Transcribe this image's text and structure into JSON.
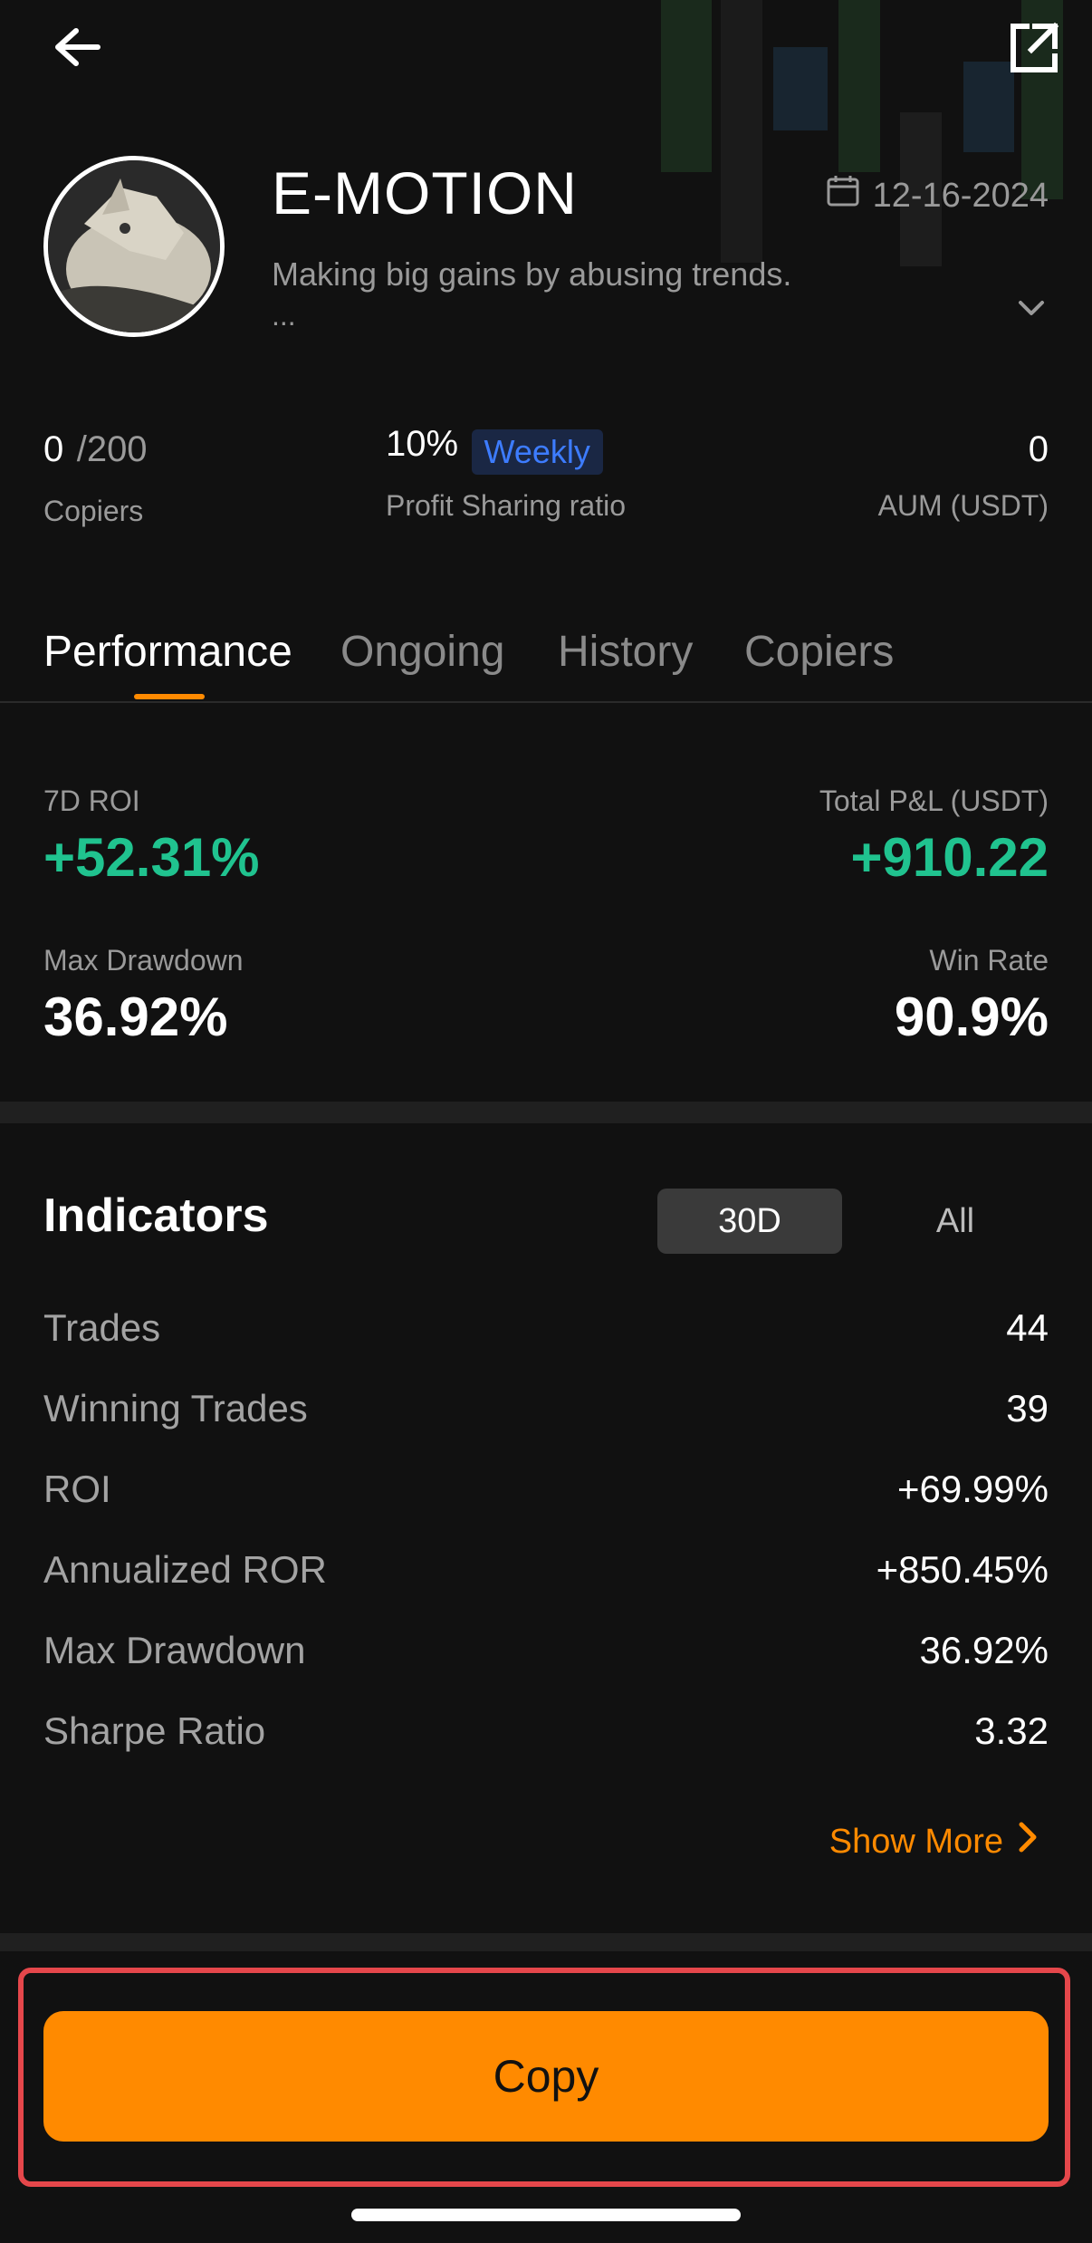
{
  "profile": {
    "name": "E-MOTION",
    "date": "12-16-2024",
    "bio": "Making big gains by abusing trends.",
    "bio_more": "..."
  },
  "stats": {
    "copiers_value": "0",
    "copiers_max": "/200",
    "copiers_label": "Copiers",
    "profit_share_value": "10%",
    "profit_share_badge": "Weekly",
    "profit_share_label": "Profit Sharing ratio",
    "aum_value": "0",
    "aum_label": "AUM (USDT)"
  },
  "tabs": [
    {
      "label": "Performance",
      "active": true
    },
    {
      "label": "Ongoing",
      "active": false
    },
    {
      "label": "History",
      "active": false
    },
    {
      "label": "Copiers",
      "active": false
    }
  ],
  "performance": {
    "roi_label": "7D ROI",
    "roi_value": "+52.31%",
    "pnl_label": "Total P&L (USDT)",
    "pnl_value": "+910.22",
    "drawdown_label": "Max Drawdown",
    "drawdown_value": "36.92%",
    "winrate_label": "Win Rate",
    "winrate_value": "90.9%"
  },
  "indicators": {
    "title": "Indicators",
    "period_selected": "30D",
    "period_other": "All",
    "rows": [
      {
        "label": "Trades",
        "value": "44"
      },
      {
        "label": "Winning Trades",
        "value": "39"
      },
      {
        "label": "ROI",
        "value": "+69.99%"
      },
      {
        "label": "Annualized ROR",
        "value": "+850.45%"
      },
      {
        "label": "Max Drawdown",
        "value": "36.92%"
      },
      {
        "label": "Sharpe Ratio",
        "value": "3.32"
      }
    ],
    "show_more": "Show More"
  },
  "actions": {
    "copy_label": "Copy"
  },
  "colors": {
    "background": "#111111",
    "accent": "#ff8a00",
    "positive": "#20c38f",
    "badge_text": "#3d7cff",
    "highlight_border": "#e5474b"
  },
  "icons": {
    "back": "back-arrow-icon",
    "share": "share-icon",
    "calendar": "calendar-icon",
    "expand": "chevron-down-icon",
    "show_more": "chevron-right-icon"
  }
}
